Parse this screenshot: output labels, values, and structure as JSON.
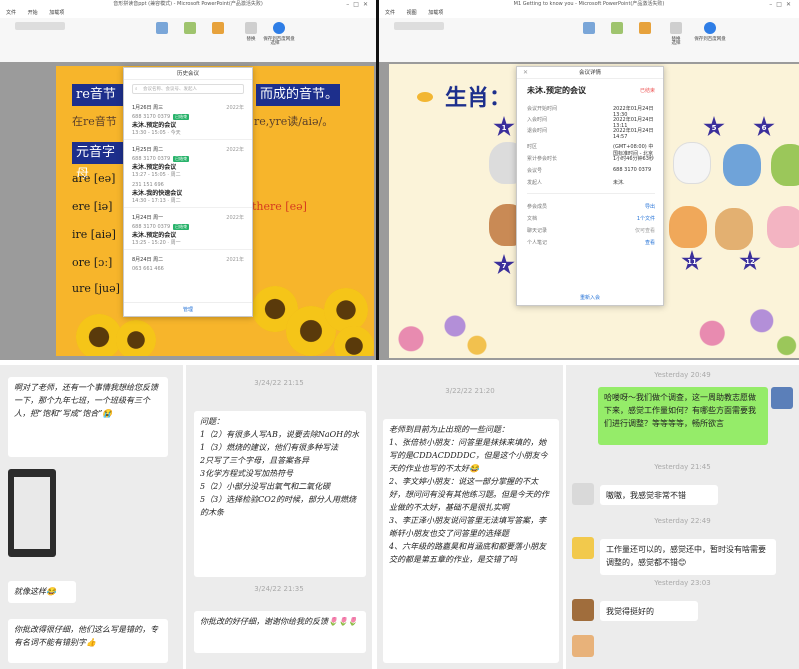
{
  "left_window": {
    "title": "音形拼读音ppt (兼容模式) - Microsoft PowerPoint(产品激活失败)",
    "tabs": [
      "文件",
      "开始",
      "加载项"
    ],
    "tools": [
      "替换",
      "选择",
      "保存到百度网盘"
    ],
    "slide": {
      "heading_left": "re音节",
      "heading_right": "而成的音节。",
      "line2": "在re音节",
      "line2_right": "re,yre读/aiə/。",
      "heading2": "元音字母",
      "rows": [
        "are [eə]",
        "ere [iə]",
        "ire [aiə]",
        "ore [ɔː]",
        "ure [juə]"
      ],
      "there": "there [eə]"
    },
    "dialog": {
      "title": "历史会议",
      "search_placeholder": "会议名称、会议号、发起人",
      "groups": [
        {
          "date": "1月26日 周三",
          "year": "2022年",
          "items": [
            {
              "id": "688 3170 0379",
              "status": "已结束",
              "title": "未沐.预定的会议",
              "time": "13:30 - 15:05 · 今天"
            }
          ]
        },
        {
          "date": "1月25日 周二",
          "year": "2022年",
          "items": [
            {
              "id": "688 3170 0379",
              "status": "已结束",
              "title": "未沐.预定的会议",
              "time": "13:27 - 15:05 · 周二"
            },
            {
              "id": "231 151 696",
              "status": "",
              "title": "未沐.我的快速会议",
              "time": "14:30 - 17:13 · 周二"
            }
          ]
        },
        {
          "date": "1月24日 周一",
          "year": "2022年",
          "items": [
            {
              "id": "688 3170 0379",
              "status": "已结束",
              "title": "未沐.预定的会议",
              "time": "13:25 - 15:20 · 周一"
            }
          ]
        },
        {
          "date": "8月24日 周二",
          "year": "2021年",
          "items": [
            {
              "id": "063 661 466",
              "status": "",
              "title": "",
              "time": ""
            }
          ]
        }
      ],
      "manage_button": "管理"
    }
  },
  "right_window": {
    "title": "M1 Getting to know you - Microsoft PowerPoint(产品激活失败)",
    "tabs": [
      "文件",
      "视图",
      "加载项"
    ],
    "tools": [
      "替换",
      "选择",
      "保存到百度网盘"
    ],
    "slide": {
      "title": "生肖：",
      "stars": [
        "1",
        "2",
        "3",
        "4",
        "5",
        "6",
        "7",
        "8",
        "9",
        "10",
        "11",
        "12"
      ]
    },
    "dialog": {
      "title": "会议详情",
      "meeting_title": "未沐.预定的会议",
      "meeting_tag": "已结束",
      "rows": [
        {
          "k": "会议开始时间",
          "v": "2022年01月24日 13:30"
        },
        {
          "k": "入会时间",
          "v": "2022年01月24日 13:11"
        },
        {
          "k": "退会时间",
          "v": "2022年01月24日 14:57"
        },
        {
          "k": "时区",
          "v": "(GMT+08:00) 中国标准时间 - 北京"
        },
        {
          "k": "累计参会时长",
          "v": "1小时46分钟63秒"
        },
        {
          "k": "会议号",
          "v": "688 3170 0379"
        },
        {
          "k": "发起人",
          "v": "未沐."
        }
      ],
      "sections": [
        {
          "k": "参会成员",
          "r": "导出"
        },
        {
          "k": "文档",
          "r": "1个文件"
        },
        {
          "k": "聊天记录",
          "r": "仅可查看"
        },
        {
          "k": "个人笔记",
          "r": "查看"
        }
      ],
      "join_button": "重新入会"
    }
  },
  "chats": {
    "c1": {
      "messages": [
        "啊对了老师，还有一个事情我想给您反馈一下，那个九年七班，一个班级有三个人，把“饱和”写成“饱合”😭",
        "就像这样😂",
        "你批改得很仔细，他们这么写是错的，专有名词不能有错别字👍"
      ]
    },
    "c2": {
      "timestamp1": "3/24/22 21:15",
      "message1": "问题：\n1（2）有很多人写AB，说要去除NaOH的水\n1（3）燃烧的建议，他们有很多种写法\n2只写了三个字母，且答案各异\n3化学方程式没写加热符号\n5（2）小部分没写出氧气和二氧化碳\n5（3）选择检验CO2的时候，部分人用燃烧的木条",
      "timestamp2": "3/24/22 21:35",
      "message2": "你批改的好仔细，谢谢你给我的反馈🌷🌷🌷"
    },
    "c3": {
      "timestamp": "3/22/22 21:20",
      "message": "老师到目前为止出现的一些问题：\n1、张倍祯小朋友：问答里是抹抹来填的，她写的是CDDACDDDDC，但是这个小朋友今天的作业也写的不太好😂\n2、李文婷小朋友：说这一部分掌握的不太好，想问问有没有其他练习题。但是今天的作业做的不太好，基础不是很扎实啊\n3、李正泽小朋友说问答里无法填写答案，李晰轩小朋友也交了问答里的选择题\n4、六年级的路嘉昊和肖涵底和都要落小朋友交的都是第五章的作业，是交错了吗"
    },
    "c4": {
      "time1": "Yesterday 20:49",
      "msg1": "哈喽呀～我们做个调查，这一周助教志愿做下来，感觉工作量如何？有哪些方面需要我们进行调整？等等等等，畅所欲言",
      "time2": "Yesterday 21:45",
      "msg2": "嗷嗷，我感觉非常不错",
      "time3": "Yesterday 22:49",
      "msg3": "工作量还可以的，感觉还中，暂时没有啥需要调整的，感觉都不错😊",
      "time4": "Yesterday 23:03",
      "msg4": "我觉得挺好的"
    }
  },
  "colors": {
    "ppt_ribbon": "#f4f4f4",
    "slide_left": "#f7b52b",
    "slide_right": "#fbf3d9",
    "star": "#3b2f9b",
    "chat_bg": "#ececec",
    "wechat_green": "#95ec69"
  }
}
